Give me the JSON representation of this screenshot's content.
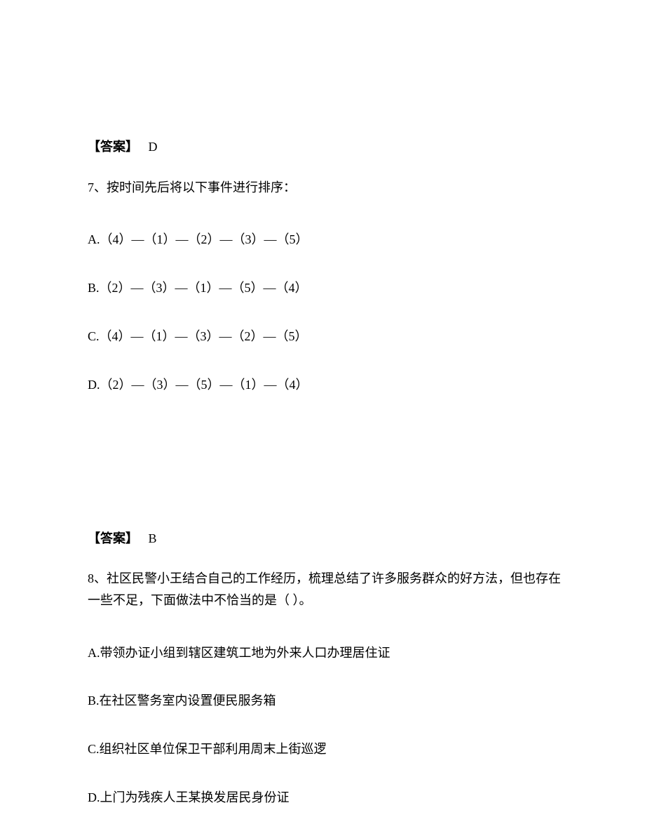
{
  "answer6": {
    "label": "【答案】",
    "value": "D"
  },
  "question7": {
    "number": "7、",
    "text": "按时间先后将以下事件进行排序：",
    "options": {
      "a": "A.（4）—（1）—（2）—（3）—（5）",
      "b": "B.（2）—（3）—（1）—（5）—（4）",
      "c": "C.（4）—（1）—（3）—（2）—（5）",
      "d": "D.（2）—（3）—（5）—（1）—（4）"
    }
  },
  "answer7": {
    "label": "【答案】",
    "value": "B"
  },
  "question8": {
    "number": "8、",
    "text": "社区民警小王结合自己的工作经历，梳理总结了许多服务群众的好方法，但也存在一些不足，下面做法中不恰当的是（ ）。",
    "options": {
      "a": "A.带领办证小组到辖区建筑工地为外来人口办理居住证",
      "b": "B.在社区警务室内设置便民服务箱",
      "c": "C.组织社区单位保卫干部利用周末上街巡逻",
      "d": "D.上门为残疾人王某换发居民身份证"
    }
  }
}
